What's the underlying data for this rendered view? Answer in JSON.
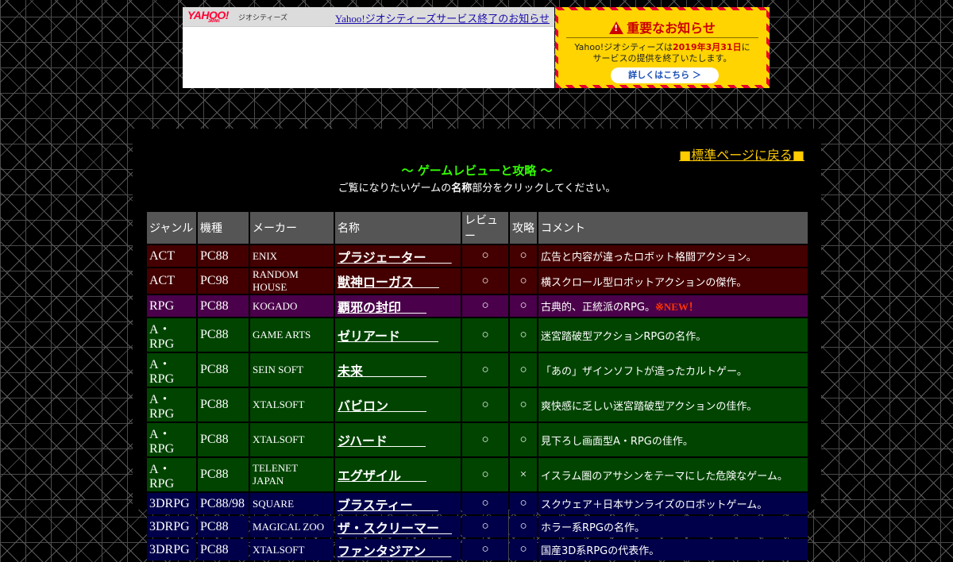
{
  "banner": {
    "logo_text": "YAHOO!",
    "logo_sub": "JAPAN",
    "service_label": "ジオシティーズ",
    "link_text": "Yahoo!ジオシティーズサービス終了のお知らせ"
  },
  "notice": {
    "title": "重要なお知らせ",
    "line1_prefix": "Yahoo!ジオシティーズは",
    "date": "2019年3月31日",
    "line1_suffix": "に",
    "line2": "サービスの提供を終了いたします。",
    "button": "詳しくはこちら ＞"
  },
  "page": {
    "back_link": "■標準ページに戻る■",
    "title": "～ ゲームレビューと攻略 ～",
    "subtitle_prefix": "ご覧になりたいゲームの",
    "subtitle_bold": "名称",
    "subtitle_suffix": "部分をクリックしてください。"
  },
  "table": {
    "headers": [
      "ジャンル",
      "機種",
      "メーカー",
      "名称",
      "レビュー",
      "攻略",
      "コメント"
    ],
    "rows": [
      {
        "genre": "ACT",
        "platform": "PC88",
        "maker": "ENIX",
        "name": "プラジェーター　　",
        "review": "○",
        "guide": "○",
        "comment": "広告と内容が違ったロボット格闘アクション。",
        "new": ""
      },
      {
        "genre": "ACT",
        "platform": "PC98",
        "maker": "RANDOM HOUSE",
        "name": "獣神ローガス　　",
        "review": "○",
        "guide": "○",
        "comment": "横スクロール型ロボットアクションの傑作。",
        "new": ""
      },
      {
        "genre": "RPG",
        "platform": "PC88",
        "maker": "KOGADO",
        "name": "覇邪の封印　　",
        "review": "○",
        "guide": "○",
        "comment": "古典的、正統派のRPG。",
        "new": "※NEW！"
      },
      {
        "genre": "A・RPG",
        "platform": "PC88",
        "maker": "GAME ARTS",
        "name": "ゼリアード　　　",
        "review": "○",
        "guide": "○",
        "comment": "迷宮踏破型アクションRPGの名作。",
        "new": ""
      },
      {
        "genre": "A・RPG",
        "platform": "PC88",
        "maker": "SEIN SOFT",
        "name": "未来　　　　　",
        "review": "○",
        "guide": "○",
        "comment": "「あの」ザインソフトが造ったカルトゲー。",
        "new": ""
      },
      {
        "genre": "A・RPG",
        "platform": "PC88",
        "maker": "XTALSOFT",
        "name": "バビロン　　　",
        "review": "○",
        "guide": "○",
        "comment": "爽快感に乏しい迷宮踏破型アクションの佳作。",
        "new": ""
      },
      {
        "genre": "A・RPG",
        "platform": "PC88",
        "maker": "XTALSOFT",
        "name": "ジハード　　　",
        "review": "○",
        "guide": "○",
        "comment": "見下ろし画面型A・RPGの佳作。",
        "new": ""
      },
      {
        "genre": "A・RPG",
        "platform": "PC88",
        "maker": "TELENET JAPAN",
        "name": "エグザイル　　",
        "review": "○",
        "guide": "×",
        "comment": "イスラム圏のアサシンをテーマにした危険なゲーム。",
        "new": ""
      },
      {
        "genre": "3DRPG",
        "platform": "PC88/98",
        "maker": "SQUARE",
        "name": "ブラスティー　　",
        "review": "○",
        "guide": "○",
        "comment": "スクウェア＋日本サンライズのロボットゲーム。",
        "new": ""
      },
      {
        "genre": "3DRPG",
        "platform": "PC88",
        "maker": "MAGICAL ZOO",
        "name": "ザ・スクリーマー　",
        "review": "○",
        "guide": "○",
        "comment": "ホラー系RPGの名作。",
        "new": ""
      },
      {
        "genre": "3DRPG",
        "platform": "PC88",
        "maker": "XTALSOFT",
        "name": "ファンタジアン　　",
        "review": "○",
        "guide": "○",
        "comment": "国産3D系RPGの代表作。",
        "new": ""
      }
    ]
  },
  "colors": {
    "act": "#440000",
    "rpg": "#4a004a",
    "arpg": "#004400",
    "drpg": "#00004a",
    "title": "#33ff00",
    "back_link": "#ffcc00",
    "new_mark": "#ff3300"
  }
}
